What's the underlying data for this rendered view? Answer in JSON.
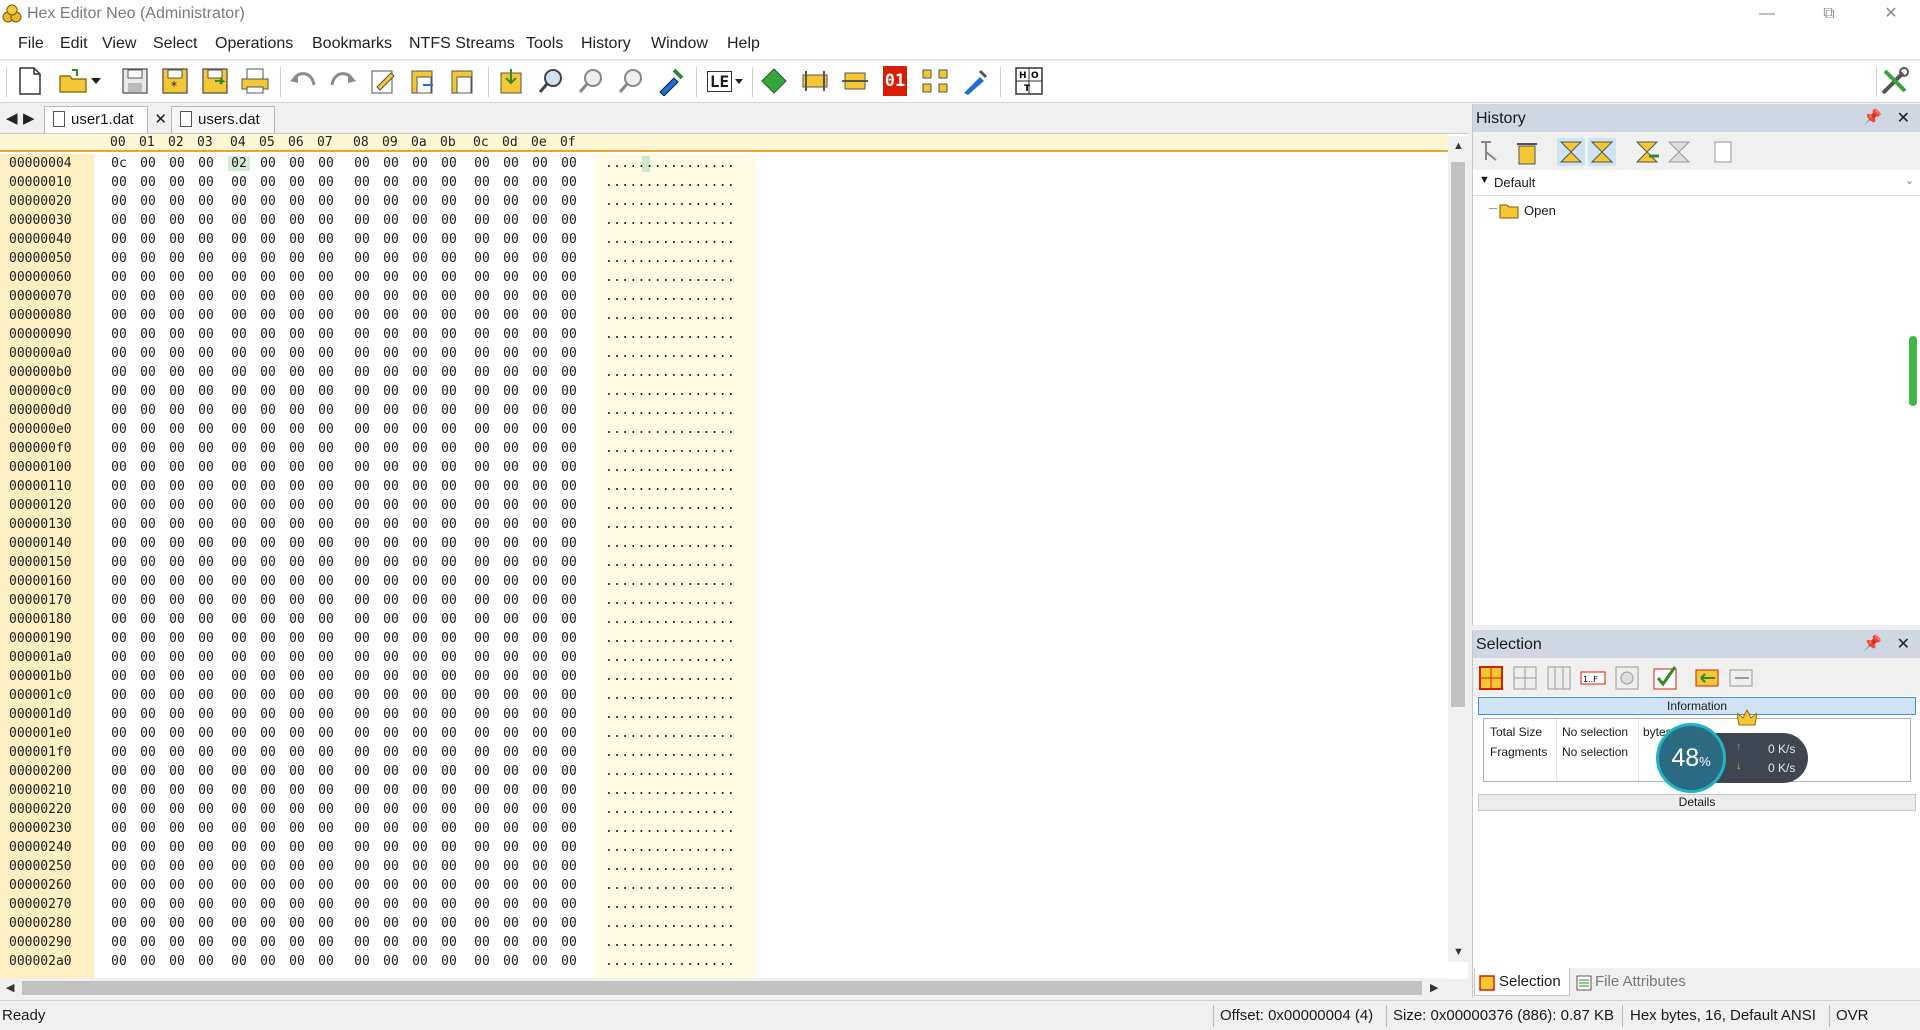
{
  "window": {
    "title": "Hex Editor Neo (Administrator)"
  },
  "menu": [
    "File",
    "Edit",
    "View",
    "Select",
    "Operations",
    "Bookmarks",
    "NTFS Streams",
    "Tools",
    "History",
    "Window",
    "Help"
  ],
  "toolbar": {
    "buttons": [
      "new-file",
      "open-file",
      "save",
      "save-all",
      "save-as",
      "print",
      "undo",
      "redo",
      "edit",
      "paste-new",
      "paste",
      "import",
      "find",
      "find-next",
      "find-previous",
      "goto",
      "endianness",
      "insert",
      "block",
      "fill",
      "binary",
      "structure",
      "pattern",
      "encoding",
      "settings"
    ],
    "endian_label": "LE",
    "binary_label": "01"
  },
  "tabs": [
    {
      "label": "user1.dat",
      "active": true
    },
    {
      "label": "users.dat",
      "active": false
    }
  ],
  "hex": {
    "columns": [
      "00",
      "01",
      "02",
      "03",
      "04",
      "05",
      "06",
      "07",
      "08",
      "09",
      "0a",
      "0b",
      "0c",
      "0d",
      "0e",
      "0f"
    ],
    "first_row": {
      "offset": "00000004",
      "bytes": [
        "0c",
        "00",
        "00",
        "00",
        "02",
        "00",
        "00",
        "00",
        "00",
        "00",
        "00",
        "00",
        "00",
        "00",
        "00",
        "00"
      ]
    },
    "zero_row_offsets": [
      "00000010",
      "00000020",
      "00000030",
      "00000040",
      "00000050",
      "00000060",
      "00000070",
      "00000080",
      "00000090",
      "000000a0",
      "000000b0",
      "000000c0",
      "000000d0",
      "000000e0",
      "000000f0",
      "00000100",
      "00000110",
      "00000120",
      "00000130",
      "00000140",
      "00000150",
      "00000160",
      "00000170",
      "00000180",
      "00000190",
      "000001a0",
      "000001b0",
      "000001c0",
      "000001d0",
      "000001e0",
      "000001f0",
      "00000200",
      "00000210",
      "00000220",
      "00000230",
      "00000240",
      "00000250",
      "00000260",
      "00000270",
      "00000280",
      "00000290",
      "000002a0"
    ],
    "zero_byte": "00",
    "ascii_row": "................",
    "selected_byte_index": 4
  },
  "history_panel": {
    "title": "History",
    "branch": "Default",
    "items": [
      "Open"
    ]
  },
  "selection_panel": {
    "title": "Selection",
    "info_header": "Information",
    "rows": [
      {
        "label": "Total Size",
        "value": "No selection",
        "unit": "bytes"
      },
      {
        "label": "Fragments",
        "value": "No selection",
        "unit": ""
      }
    ],
    "details_header": "Details",
    "bottom_tabs": [
      "Selection",
      "File Attributes"
    ]
  },
  "speed_widget": {
    "percent": "48",
    "percent_sign": "%",
    "up": "0",
    "down": "0",
    "unit": "K/s"
  },
  "status": {
    "ready": "Ready",
    "offset": "Offset: 0x00000004 (4)",
    "size": "Size: 0x00000376 (886): 0.87 KB",
    "mode": "Hex bytes, 16, Default ANSI",
    "ovr": "OVR"
  },
  "colors": {
    "offset_bg": "#fcefc2",
    "ascii_bg": "#fffbe4",
    "header_border": "#e9a82b",
    "panel_head": "#cfd7e2",
    "selection_green": "#d6ecd7"
  }
}
